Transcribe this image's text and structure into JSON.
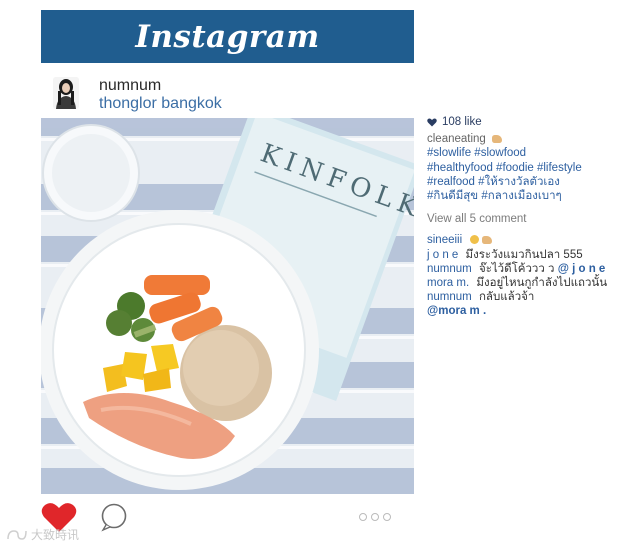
{
  "header": {
    "logo_text": "Instagram",
    "bar_color": "#205d8f"
  },
  "post": {
    "username": "numnum",
    "location": "thonglor bangkok",
    "photo_magazine_title": "KINFOLK"
  },
  "side": {
    "likes": "108 like",
    "caption": "cleaneating",
    "hashtags": [
      "#slowlife #slowfood",
      "#healthyfood #foodie #lifestyle",
      "#realfood #ให้รางวัลตัวเอง",
      "#กินดีมีสุข #กลางเมืองเบาๆ"
    ],
    "view_all": "View all 5 comment",
    "comments": [
      {
        "user": "sineeiii",
        "text": "",
        "emoji": [
          "smile-emoji",
          "muscle-emoji"
        ]
      },
      {
        "user": "j o n e",
        "text": "มึงระวังแมวกินปลา 555"
      },
      {
        "user": "numnum",
        "text": "จ๊ะไว้ดีโค้ววว ว",
        "mention": "@ j o n e"
      },
      {
        "user": "mora m.",
        "text": "มึงอยู่ไหนกูกำลังไปแถวนั้น"
      },
      {
        "user": "numnum",
        "text": "กลับแล้วจ้า"
      },
      {
        "user": "",
        "text": "",
        "mention": "@mora m ."
      }
    ]
  },
  "actions": {
    "like_color": "#e0262a"
  },
  "watermark": {
    "text": "大致時讯"
  }
}
